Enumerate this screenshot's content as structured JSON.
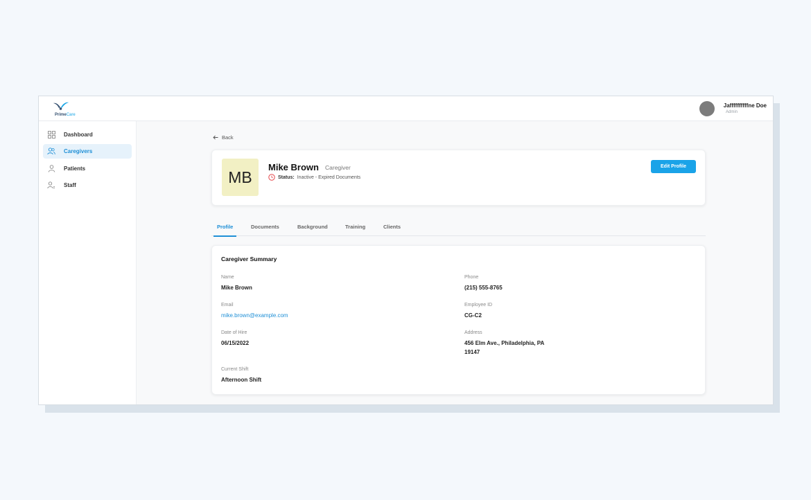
{
  "brand": {
    "name_part1": "Prime",
    "name_part2": "Care"
  },
  "user": {
    "name": "Jaffffffffffne Doe",
    "role": "Admin"
  },
  "sidebar": {
    "items": [
      {
        "label": "Dashboard",
        "icon": "dashboard-icon",
        "active": false
      },
      {
        "label": "Caregivers",
        "icon": "users-icon",
        "active": true
      },
      {
        "label": "Patients",
        "icon": "user-icon",
        "active": false
      },
      {
        "label": "Staff",
        "icon": "staff-icon",
        "active": false
      }
    ]
  },
  "back_label": "Back",
  "profile": {
    "initials": "MB",
    "name": "Mike Brown",
    "role": "Caregiver",
    "status_label": "Status:",
    "status_value": "Inactive - Expired Documents",
    "edit_label": "Edit Profile"
  },
  "tabs": [
    "Profile",
    "Documents",
    "Background",
    "Training",
    "Clients"
  ],
  "active_tab": "Profile",
  "summary": {
    "title": "Caregiver Summary",
    "fields": {
      "name": {
        "label": "Name",
        "value": "Mike Brown"
      },
      "phone": {
        "label": "Phone",
        "value": "(215) 555-8765"
      },
      "email": {
        "label": "Email",
        "value": "mike.brown@example.com"
      },
      "employee_id": {
        "label": "Employee ID",
        "value": "CG-C2"
      },
      "date_of_hire": {
        "label": "Date of Hire",
        "value": "06/15/2022"
      },
      "address": {
        "label": "Address",
        "line1": "456 Elm Ave., Philadelphia, PA",
        "line2": "19147"
      },
      "current_shift": {
        "label": "Current Shift",
        "value": "Afternoon Shift"
      }
    }
  },
  "colors": {
    "accent": "#1aa3e8",
    "active_nav_bg": "#e6f2fb",
    "status_icon": "#e5484d",
    "initials_bg": "#f2f0c4"
  }
}
